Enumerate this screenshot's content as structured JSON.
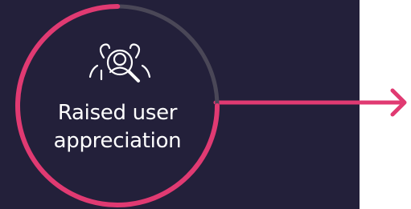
{
  "card": {
    "label_line1": "Raised user",
    "label_line2": "appreciation",
    "icon": "user-group-search-icon",
    "progress": 0.75
  },
  "colors": {
    "background_dark": "#23203a",
    "background_light": "#ffffff",
    "accent": "#e03a72",
    "ring_track": "#4a4757",
    "text": "#ffffff"
  }
}
